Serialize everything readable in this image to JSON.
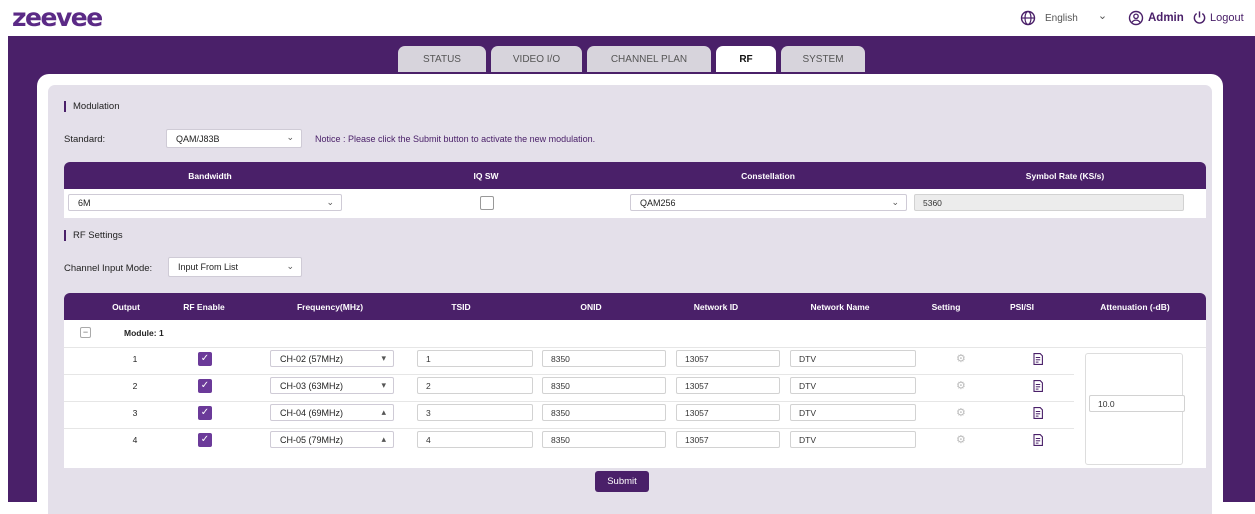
{
  "brand": {
    "logo": "zeevee"
  },
  "header": {
    "language": "English",
    "chevron": "⌄",
    "user": "Admin",
    "logout": "Logout"
  },
  "tabs": [
    {
      "label": "STATUS",
      "active": false
    },
    {
      "label": "VIDEO I/O",
      "active": false
    },
    {
      "label": "CHANNEL PLAN",
      "active": false
    },
    {
      "label": "RF",
      "active": true
    },
    {
      "label": "SYSTEM",
      "active": false
    }
  ],
  "modulation": {
    "title": "Modulation",
    "standard_label": "Standard:",
    "standard_value": "QAM/J83B",
    "notice": "Notice : Please click the Submit button to activate the new modulation.",
    "headers": {
      "bandwidth": "Bandwidth",
      "iqsw": "IQ SW",
      "constellation": "Constellation",
      "symbol_rate": "Symbol Rate (KS/s)"
    },
    "bandwidth": "6M",
    "iq_sw_checked": false,
    "constellation": "QAM256",
    "symbol_rate": "5360"
  },
  "rf": {
    "title": "RF Settings",
    "input_mode_label": "Channel Input Mode:",
    "input_mode_value": "Input From List",
    "headers": {
      "output": "Output",
      "rf_enable": "RF Enable",
      "frequency": "Frequency(MHz)",
      "tsid": "TSID",
      "onid": "ONID",
      "network_id": "Network ID",
      "network_name": "Network Name",
      "setting": "Setting",
      "psisi": "PSI/SI",
      "attenuation": "Attenuation (-dB)"
    },
    "module_toggle": "−",
    "module_label": "Module: 1",
    "rows": [
      {
        "output": "1",
        "enabled": true,
        "frequency": "CH-02 (57MHz)",
        "arrow": "▾",
        "tsid": "1",
        "onid": "8350",
        "network_id": "13057",
        "network_name": "DTV"
      },
      {
        "output": "2",
        "enabled": true,
        "frequency": "CH-03 (63MHz)",
        "arrow": "▾",
        "tsid": "2",
        "onid": "8350",
        "network_id": "13057",
        "network_name": "DTV"
      },
      {
        "output": "3",
        "enabled": true,
        "frequency": "CH-04 (69MHz)",
        "arrow": "▴",
        "tsid": "3",
        "onid": "8350",
        "network_id": "13057",
        "network_name": "DTV"
      },
      {
        "output": "4",
        "enabled": true,
        "frequency": "CH-05 (79MHz)",
        "arrow": "▴",
        "tsid": "4",
        "onid": "8350",
        "network_id": "13057",
        "network_name": "DTV"
      }
    ],
    "attenuation": "10.0"
  },
  "submit_label": "Submit",
  "colors": {
    "brand": "#4a2069",
    "panel": "#e4e0ea",
    "check": "#6b3a99"
  }
}
